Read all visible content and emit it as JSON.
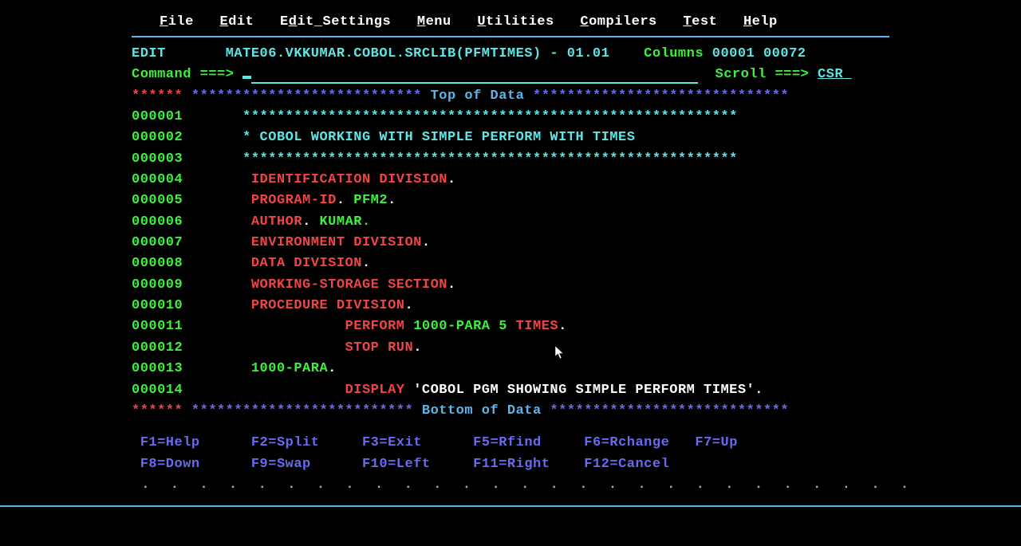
{
  "menu": {
    "file": "File",
    "edit": "Edit",
    "edit_settings": "Edit_Settings",
    "menu": "Menu",
    "utilities": "Utilities",
    "compilers": "Compilers",
    "test": "Test",
    "help": "Help"
  },
  "header": {
    "mode": "EDIT",
    "dataset": "MATE06.VKKUMAR.COBOL.SRCLIB(PFMTIMES) - 01.01",
    "columns_label": "Columns",
    "columns_value": "00001 00072",
    "command_label": "Command ===>",
    "scroll_label": "Scroll ===>",
    "scroll_value": "CSR "
  },
  "top_marker": {
    "stars_left": "******",
    "fill_left": "***************************",
    "label": " Top of Data ",
    "fill_right": "******************************"
  },
  "lines": [
    {
      "num": "000001",
      "segments": [
        {
          "indent": "       ",
          "text": "**********************************************************",
          "cls": "cyan"
        }
      ]
    },
    {
      "num": "000002",
      "segments": [
        {
          "indent": "       ",
          "text": "* COBOL WORKING WITH SIMPLE PERFORM WITH TIMES",
          "cls": "cyan"
        }
      ]
    },
    {
      "num": "000003",
      "segments": [
        {
          "indent": "       ",
          "text": "**********************************************************",
          "cls": "cyan"
        }
      ]
    },
    {
      "num": "000004",
      "segments": [
        {
          "indent": "        ",
          "text": "IDENTIFICATION DIVISION",
          "cls": "red"
        },
        {
          "text": ".",
          "cls": "white"
        }
      ]
    },
    {
      "num": "000005",
      "segments": [
        {
          "indent": "        ",
          "text": "PROGRAM-ID",
          "cls": "red"
        },
        {
          "text": ". ",
          "cls": "white"
        },
        {
          "text": "PFM2",
          "cls": "green"
        },
        {
          "text": ".",
          "cls": "white"
        }
      ]
    },
    {
      "num": "000006",
      "segments": [
        {
          "indent": "        ",
          "text": "AUTHOR",
          "cls": "red"
        },
        {
          "text": ". ",
          "cls": "white"
        },
        {
          "text": "KUMAR.",
          "cls": "green"
        }
      ]
    },
    {
      "num": "000007",
      "segments": [
        {
          "indent": "        ",
          "text": "ENVIRONMENT DIVISION",
          "cls": "red"
        },
        {
          "text": ".",
          "cls": "white"
        }
      ]
    },
    {
      "num": "000008",
      "segments": [
        {
          "indent": "        ",
          "text": "DATA DIVISION",
          "cls": "red"
        },
        {
          "text": ".",
          "cls": "white"
        }
      ]
    },
    {
      "num": "000009",
      "segments": [
        {
          "indent": "        ",
          "text": "WORKING-STORAGE SECTION",
          "cls": "red"
        },
        {
          "text": ".",
          "cls": "white"
        }
      ]
    },
    {
      "num": "000010",
      "segments": [
        {
          "indent": "        ",
          "text": "PROCEDURE DIVISION",
          "cls": "red"
        },
        {
          "text": ".",
          "cls": "white"
        }
      ]
    },
    {
      "num": "000011",
      "segments": [
        {
          "indent": "                   ",
          "text": "PERFORM",
          "cls": "red"
        },
        {
          "text": " ",
          "cls": "white"
        },
        {
          "text": "1000-PARA 5",
          "cls": "green"
        },
        {
          "text": " ",
          "cls": "white"
        },
        {
          "text": "TIMES",
          "cls": "red"
        },
        {
          "text": ".",
          "cls": "white"
        }
      ]
    },
    {
      "num": "000012",
      "segments": [
        {
          "indent": "                   ",
          "text": "STOP RUN",
          "cls": "red"
        },
        {
          "text": ".",
          "cls": "white"
        }
      ]
    },
    {
      "num": "000013",
      "segments": [
        {
          "indent": "        ",
          "text": "1000-PARA",
          "cls": "green"
        },
        {
          "text": ".",
          "cls": "white"
        }
      ]
    },
    {
      "num": "000014",
      "segments": [
        {
          "indent": "                   ",
          "text": "DISPLAY",
          "cls": "red"
        },
        {
          "text": " ",
          "cls": "white"
        },
        {
          "text": "'COBOL PGM SHOWING SIMPLE PERFORM TIMES'",
          "cls": "white"
        },
        {
          "text": ".",
          "cls": "white"
        }
      ]
    }
  ],
  "bottom_marker": {
    "stars_left": "******",
    "fill_left": "**************************",
    "label": " Bottom of Data ",
    "fill_right": "****************************"
  },
  "fnkeys": {
    "row1": [
      "F1=Help",
      "F2=Split",
      "F3=Exit",
      "F5=Rfind",
      "F6=Rchange",
      "F7=Up"
    ],
    "row2": [
      "F8=Down",
      "F9=Swap",
      "F10=Left",
      "F11=Right",
      "F12=Cancel"
    ]
  },
  "dots": " .  .  .  .  .  .  .  .  .  .  .  .  .  .  .  .  .  .  .  .  .  .  .  .  .  .  ."
}
